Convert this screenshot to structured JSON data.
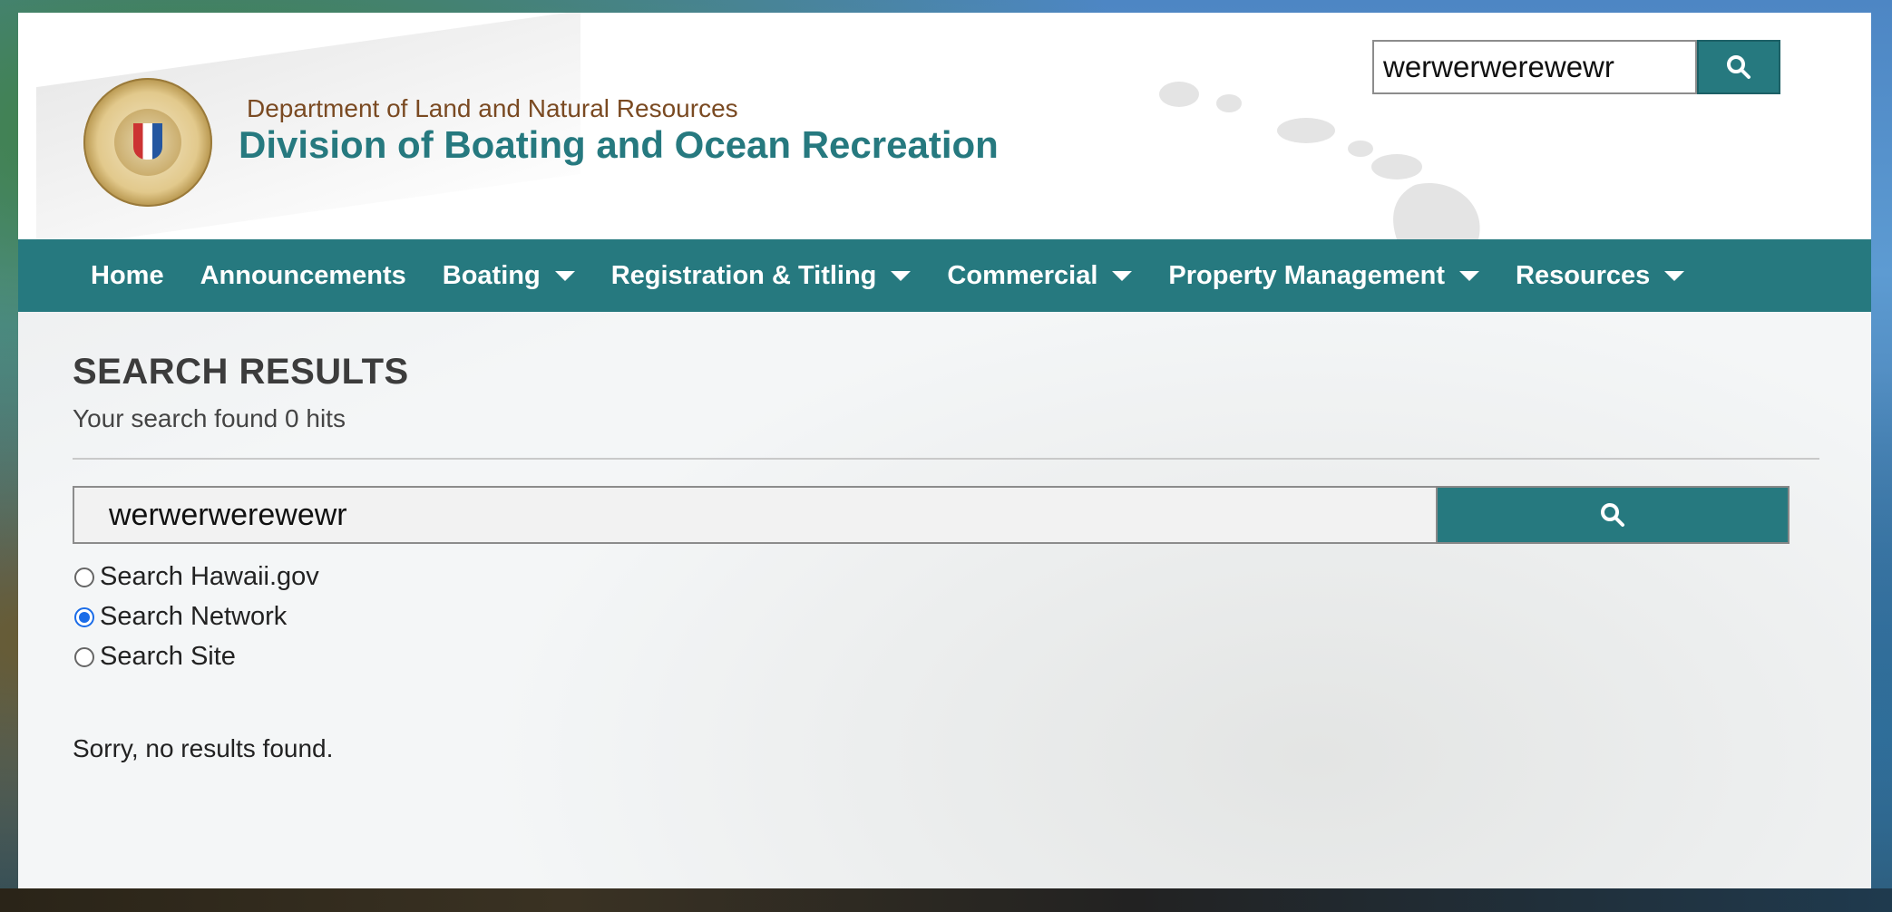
{
  "header": {
    "department": "Department of Land and Natural Resources",
    "division": "Division of Boating and Ocean Recreation",
    "seal_icon": "state-of-hawaii-seal",
    "search_value": "werwerwerewewr",
    "search_icon": "search-icon"
  },
  "nav": {
    "items": [
      {
        "label": "Home",
        "dropdown": false
      },
      {
        "label": "Announcements",
        "dropdown": false
      },
      {
        "label": "Boating",
        "dropdown": true
      },
      {
        "label": "Registration & Titling",
        "dropdown": true
      },
      {
        "label": "Commercial",
        "dropdown": true
      },
      {
        "label": "Property Management",
        "dropdown": true
      },
      {
        "label": "Resources",
        "dropdown": true
      }
    ]
  },
  "main": {
    "title": "SEARCH RESULTS",
    "hits_text": "Your search found 0 hits",
    "search_value": "werwerwerewewr",
    "radio_options": [
      {
        "label": "Search Hawaii.gov",
        "checked": false
      },
      {
        "label": "Search Network",
        "checked": true
      },
      {
        "label": "Search Site",
        "checked": false
      }
    ],
    "no_results": "Sorry, no results found."
  },
  "colors": {
    "accent": "#26797f",
    "department_text": "#7a4a22",
    "radio_selected": "#1a6ce8"
  }
}
